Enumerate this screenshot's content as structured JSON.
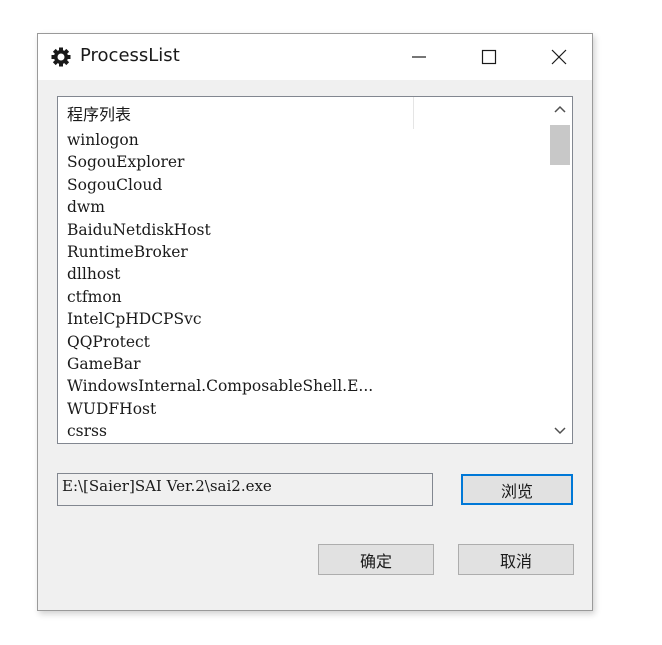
{
  "window": {
    "title": "ProcessList",
    "icon": "gear-icon",
    "controls": {
      "minimize": "minimize-icon",
      "maximize": "maximize-icon",
      "close": "close-icon"
    }
  },
  "list": {
    "header": "程序列表",
    "items": [
      "winlogon",
      "SogouExplorer",
      "SogouCloud",
      "dwm",
      "BaiduNetdiskHost",
      "RuntimeBroker",
      "dllhost",
      "ctfmon",
      "IntelCpHDCPSvc",
      "QQProtect",
      "GameBar",
      "WindowsInternal.ComposableShell.E...",
      "WUDFHost",
      "csrss"
    ]
  },
  "path_field": {
    "value": "E:\\[Saier]SAI Ver.2\\sai2.exe"
  },
  "buttons": {
    "browse": "浏览",
    "ok": "确定",
    "cancel": "取消"
  },
  "colors": {
    "focus_border": "#0078d7",
    "window_bg": "#f0f0f0"
  }
}
